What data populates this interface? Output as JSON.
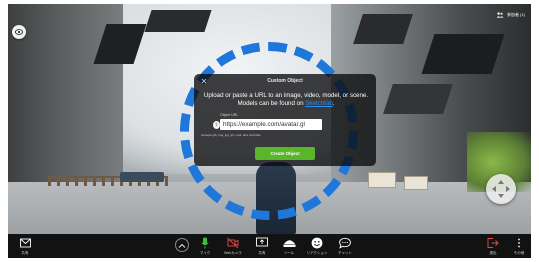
{
  "header": {
    "participants_label": "参加者 (1)"
  },
  "modal": {
    "title": "Custom Object",
    "description_pre": "Upload or paste a URL to an image, video, model, or scene. Models can be found on ",
    "description_link": "Sketchfab",
    "description_post": ".",
    "url_label": "Object URL",
    "url_value": "https://example.com/avatar.gl",
    "accepts": "Accepts glb, png, jpg, gif, mp4, and mp3 files",
    "create_button": "Create Object"
  },
  "toolbar": {
    "share": "共有",
    "mic": "マイク",
    "video": "Webカメラ",
    "screen": "共有",
    "tools": "ツール",
    "reactions": "リアクション",
    "chat": "チャット",
    "leave": "退出",
    "more": "その他"
  },
  "colors": {
    "accent_blue": "#1e77d9",
    "create_green": "#59b52a",
    "mic_green": "#3fbf3f",
    "leave_red": "#e24b4b"
  },
  "icons": [
    "eye-icon",
    "people-icon",
    "envelope-icon",
    "chevron-up-icon",
    "microphone-icon",
    "video-off-icon",
    "screen-share-icon",
    "tools-icon",
    "smile-icon",
    "chat-icon",
    "leave-icon",
    "more-icon",
    "move-icon",
    "upload-icon",
    "close-icon"
  ]
}
